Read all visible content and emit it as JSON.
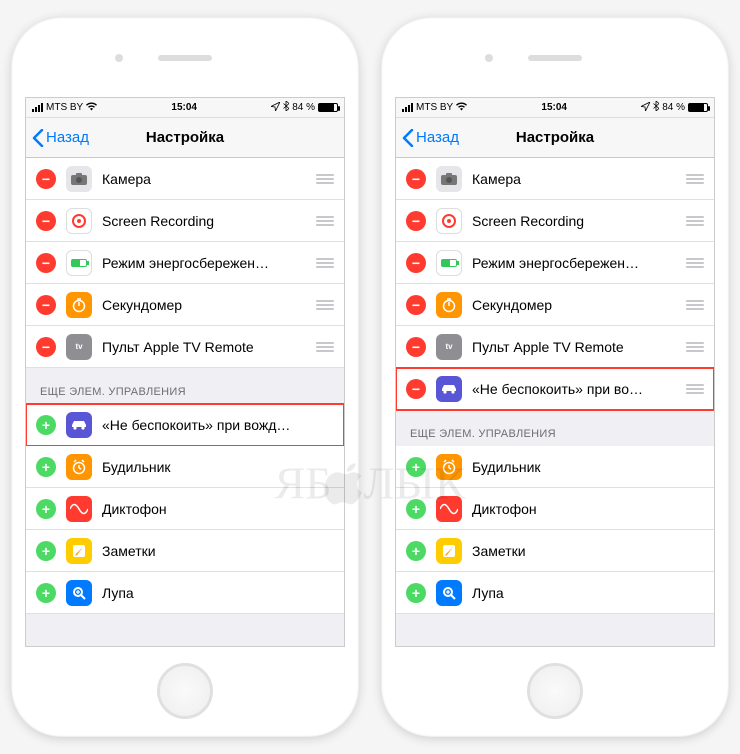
{
  "status": {
    "carrier": "MTS BY",
    "time": "15:04",
    "battery_pct": "84 %"
  },
  "nav": {
    "back": "Назад",
    "title": "Настройка"
  },
  "section_more": "ЕЩЕ ЭЛЕМ. УПРАВЛЕНИЯ",
  "included_common": {
    "camera": "Камера",
    "screenrec": "Screen Recording",
    "lowpower": "Режим энергосбережен…",
    "stopwatch": "Секундомер",
    "tvremote": "Пульт Apple TV Remote"
  },
  "dnd_drive_left": "«Не беспокоить» при вожд…",
  "dnd_drive_right": "«Не беспокоить» при во…",
  "more": {
    "alarm": "Будильник",
    "voice": "Диктофон",
    "notes": "Заметки",
    "magnifier": "Лупа"
  },
  "tv_label": "tv",
  "watermark": {
    "left": "ЯБ",
    "right": "ЛЫК"
  }
}
